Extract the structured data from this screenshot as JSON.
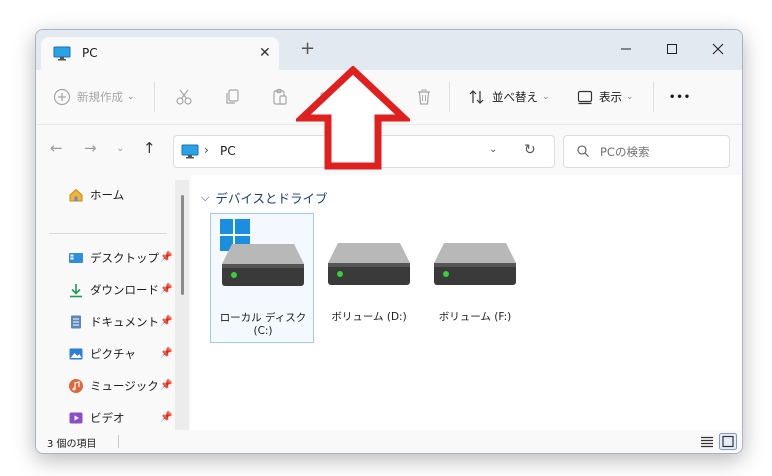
{
  "tab": {
    "title": "PC"
  },
  "toolbar": {
    "new_label": "新規作成",
    "sort_label": "並べ替え",
    "view_label": "表示",
    "more_label": "•••"
  },
  "address": {
    "location": "PC",
    "separator": "›"
  },
  "search": {
    "placeholder": "PCの検索"
  },
  "sidebar": {
    "home": "ホーム",
    "items": [
      {
        "label": "デスクトップ"
      },
      {
        "label": "ダウンロード"
      },
      {
        "label": "ドキュメント"
      },
      {
        "label": "ピクチャ"
      },
      {
        "label": "ミュージック"
      },
      {
        "label": "ビデオ"
      }
    ]
  },
  "main": {
    "group_title": "デバイスとドライブ",
    "drives": [
      {
        "label": "ローカル ディスク (C:)"
      },
      {
        "label": "ボリューム (D:)"
      },
      {
        "label": "ボリューム (F:)"
      }
    ]
  },
  "status": {
    "count_text": "3 個の項目"
  },
  "colors": {
    "annotation_red": "#e0201e",
    "accent_blue": "#0067c0",
    "drive_led": "#37d03c"
  }
}
